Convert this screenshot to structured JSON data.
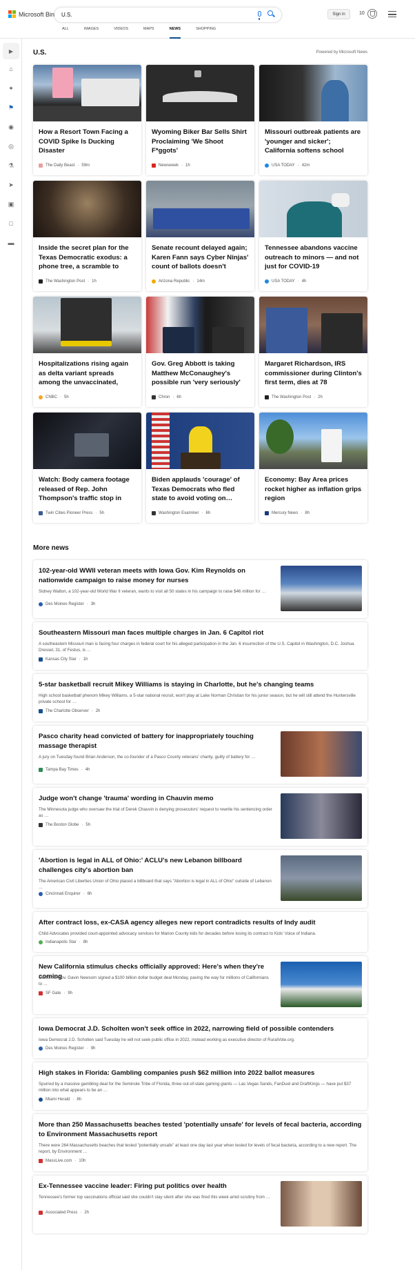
{
  "header": {
    "brand": "Microsoft Bing",
    "search_value": "U.S.",
    "signin_label": "Sign in",
    "rewards_count": "10",
    "tabs": [
      "ALL",
      "IMAGES",
      "VIDEOS",
      "MAPS",
      "NEWS",
      "SHOPPING"
    ],
    "active_tab": "NEWS"
  },
  "sidebar": {
    "icons": [
      "chevron-right-icon",
      "home-icon",
      "sports-icon",
      "flag-icon",
      "location-icon",
      "globe-icon",
      "microscope-icon",
      "rocket-icon",
      "film-icon",
      "bank-icon",
      "money-icon"
    ]
  },
  "section": {
    "title": "U.S.",
    "powered_by": "Powered by Microsoft News"
  },
  "cards": [
    {
      "title": "How a Resort Town Facing a COVID Spike Is Ducking Disaster",
      "source": "The Daily Beast",
      "time": "59m",
      "src_color": "#e8a0a0"
    },
    {
      "title": "Wyoming Biker Bar Sells Shirt Proclaiming 'We Shoot F*ggots'",
      "source": "Newsweek",
      "time": "1h",
      "src_color": "#d9281e"
    },
    {
      "title": "Missouri outbreak patients are 'younger and sicker'; California softens school rules, still…",
      "source": "USA TODAY",
      "time": "42m",
      "src_color": "#1e88e5"
    },
    {
      "title": "Inside the secret plan for the Texas Democratic exodus: a phone tree, a scramble to pac…",
      "source": "The Washington Post",
      "time": "1h",
      "src_color": "#222222"
    },
    {
      "title": "Senate recount delayed again; Karen Fann says Cyber Ninjas' count of ballots doesn't match…",
      "source": "Arizona Republic",
      "time": "14m",
      "src_color": "#f2a900"
    },
    {
      "title": "Tennessee abandons vaccine outreach to minors — and not just for COVID-19",
      "source": "USA TODAY",
      "time": "4h",
      "src_color": "#1e88e5"
    },
    {
      "title": "Hospitalizations rising again as delta variant spreads among the unvaccinated, doctors say",
      "source": "CNBC",
      "time": "5h",
      "src_color": "#f5a623"
    },
    {
      "title": "Gov. Greg Abbott is taking Matthew McConaughey's possible run 'very seriously'",
      "source": "Chron",
      "time": "6h",
      "src_color": "#333333"
    },
    {
      "title": "Margaret Richardson, IRS commissioner during Clinton's first term, dies at 78",
      "source": "The Washington Post",
      "time": "2h",
      "src_color": "#222222"
    },
    {
      "title": "Watch: Body camera footage released of Rep. John Thompson's traffic stop in St.…",
      "source": "Twin Cities Pioneer Press",
      "time": "5h",
      "src_color": "#3b5998"
    },
    {
      "title": "Biden applauds 'courage' of Texas Democrats who fled state to avoid voting on…",
      "source": "Washington Examiner",
      "time": "6h",
      "src_color": "#333333"
    },
    {
      "title": "Economy: Bay Area prices rocket higher as inflation grips region",
      "source": "Mercury News",
      "time": "8h",
      "src_color": "#1a3a7a"
    }
  ],
  "more_news": {
    "title": "More news",
    "items": [
      {
        "title": "102-year-old WWII veteran meets with Iowa Gov. Kim Reynolds on nationwide campaign to raise money for nurses",
        "snippet": "Sidney Walton, a 102-year-old World War II veteran, wants to visit all 50 states in his campaign to raise $46 million for …",
        "source": "Des Moines Register",
        "time": "3h",
        "src_color": "#2a5db0"
      },
      {
        "title": "Southeastern Missouri man faces multiple charges in Jan. 6 Capitol riot",
        "snippet": "A southeastern Missouri man is facing four charges in federal court for his alleged participation in the Jan. 6 insurrection of the U.S. Capitol in Washington, D.C. Joshua Dressel, 31, of Festus, is …",
        "source": "Kansas City Star",
        "time": "1h",
        "src_color": "#1a4f8f"
      },
      {
        "title": "5-star basketball recruit Mikey Williams is staying in Charlotte, but he's changing teams",
        "snippet": "High school basketball phenom Mikey Williams, a 5-star national recruit, won't play at Lake Norman Christian for his junior season, but he will still attend the Huntersville private school for …",
        "source": "The Charlotte Observer",
        "time": "2h",
        "src_color": "#1a4f8f"
      },
      {
        "title": "Pasco charity head convicted of battery for inappropriately touching massage therapist",
        "snippet": "A jury on Tuesday found Brian Anderson, the co-founder of a Pasco County veterans' charity, guilty of battery for …",
        "source": "Tampa Bay Times",
        "time": "4h",
        "src_color": "#2e8b57"
      },
      {
        "title": "Judge won't change 'trauma' wording in Chauvin memo",
        "snippet": "The Minnesota judge who oversaw the trial of Derek Chauvin is denying prosecutors' request to rewrite his sentencing order as …",
        "source": "The Boston Globe",
        "time": "5h",
        "src_color": "#333333"
      },
      {
        "title": "'Abortion is legal in ALL of Ohio:' ACLU's new Lebanon billboard challenges city's abortion ban",
        "snippet": "The American Civil Liberties Union of Ohio placed a billboard that says \"Abortion is legal in ALL of Ohio\" outside of Lebanon …",
        "source": "Cincinnati Enquirer",
        "time": "6h",
        "src_color": "#2a5db0"
      },
      {
        "title": "After contract loss, ex-CASA agency alleges new report contradicts results of Indy audit",
        "snippet": "Child Advocates provided court-appointed advocacy services for Marion County kids for decades before losing its contract to Kids' Voice of Indiana.",
        "source": "Indianapolis Star",
        "time": "8h",
        "src_color": "#4caf50"
      },
      {
        "title": "New California stimulus checks officially approved: Here's when they're coming",
        "snippet": "California Gov. Gavin Newsom signed a $100 billion dollar budget deal Monday, paving the way for millions of Californians to …",
        "source": "SF Gate",
        "time": "9h",
        "src_color": "#d32f2f"
      },
      {
        "title": "Iowa Democrat J.D. Scholten won't seek office in 2022, narrowing field of possible contenders",
        "snippet": "Iowa Democrat J.D. Scholten said Tuesday he will not seek public office in 2022, instead working as executive director of RuralVote.org.",
        "source": "Des Moines Register",
        "time": "9h",
        "src_color": "#2a5db0"
      },
      {
        "title": "High stakes in Florida: Gambling companies push $62 million into 2022 ballot measures",
        "snippet": "Spurred by a massive gambling deal for the Seminole Tribe of Florida, three out-of-state gaming giants — Las Vegas Sands, FanDuel and DraftKings — have put $37 million into what appears to be an …",
        "source": "Miami Herald",
        "time": "8h",
        "src_color": "#1a4f8f"
      },
      {
        "title": "More than 250 Massachusetts beaches tested 'potentially unsafe' for levels of fecal bacteria, according to Environment Massachusetts report",
        "snippet": "There were 264 Massachusetts beaches that tested \"potentially unsafe\" at least one day last year when tested for levels of fecal bacteria, according to a new report. The report, by Environment …",
        "source": "MassLive.com",
        "time": "10h",
        "src_color": "#d32f2f"
      },
      {
        "title": "Ex-Tennessee vaccine leader: Firing put politics over health",
        "snippet": "Tennessee's former top vaccinations official said she couldn't stay silent after she was fired this week amid scrutiny from …",
        "source": "Associated Press",
        "time": "2h",
        "src_color": "#d32f2f"
      }
    ]
  }
}
